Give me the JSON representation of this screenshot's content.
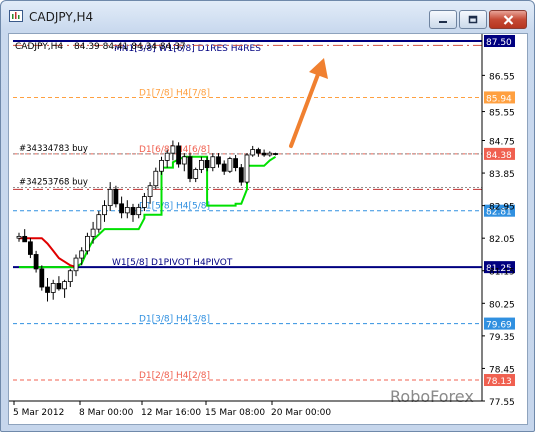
{
  "window": {
    "title": "CADJPY,H4",
    "icon": "chart-window-icon"
  },
  "chart_data": {
    "type": "candlestick",
    "symbol_header": "CADJPY,H4",
    "ohlc_header": "84.39 84.41 84.34 84.37",
    "watermark": "RoboForex",
    "ylim": [
      77.55,
      87.5
    ],
    "price_axis_ticks": [
      "86.55",
      "85.55",
      "84.75",
      "83.85",
      "82.95",
      "82.05",
      "81.15",
      "80.25",
      "79.35",
      "78.45",
      "77.55"
    ],
    "date_labels": [
      "5 Mar 2012",
      "8 Mar 00:00",
      "12 Mar 16:00",
      "15 Mar 08:00",
      "20 Mar 00:00"
    ],
    "levels": [
      {
        "price": 87.5,
        "label": "MN1[3/8] W1[6/8] D1RES H4RES",
        "tag": "87.50",
        "color": "#000080",
        "style": "solid",
        "tag_bg": "#000080",
        "tag_fg": "#ffffff"
      },
      {
        "price": 87.38,
        "label": "",
        "tag": "",
        "color": "#d05040",
        "style": "dashdot",
        "tag_bg": "",
        "tag_fg": ""
      },
      {
        "price": 85.94,
        "label": "D1[7/8] H4[7/8]",
        "tag": "85.94",
        "color": "#ffa040",
        "style": "dashed",
        "tag_bg": "#ffa040",
        "tag_fg": "#ffffff"
      },
      {
        "price": 84.38,
        "label": "D1[6/8] H4[6/8]",
        "tag": "84.38",
        "color": "#f06050",
        "style": "dashed",
        "tag_bg": "#f06050",
        "tag_fg": "#ffffff"
      },
      {
        "price": 83.4,
        "label": "",
        "tag": "",
        "color": "#c03030",
        "style": "dashdot",
        "tag_bg": "",
        "tag_fg": ""
      },
      {
        "price": 82.81,
        "label": "D1[5/8] H4[5/8]",
        "tag": "82.81",
        "color": "#3090e0",
        "style": "dashed",
        "tag_bg": "#3090e0",
        "tag_fg": "#ffffff"
      },
      {
        "price": 81.25,
        "label": "W1[5/8] D1PIVOT H4PIVOT",
        "tag": "81.25",
        "color": "#000080",
        "style": "solid",
        "tag_bg": "#000080",
        "tag_fg": "#ffffff"
      },
      {
        "price": 79.69,
        "label": "D1[3/8] H4[3/8]",
        "tag": "79.69",
        "color": "#3090e0",
        "style": "dashed",
        "tag_bg": "#3090e0",
        "tag_fg": "#ffffff"
      },
      {
        "price": 78.13,
        "label": "D1[2/8] H4[2/8]",
        "tag": "78.13",
        "color": "#f06050",
        "style": "dashed",
        "tag_bg": "#f06050",
        "tag_fg": "#ffffff"
      }
    ],
    "orders": [
      {
        "label": "#34334783 buy",
        "price": 84.38
      },
      {
        "label": "#34253768 buy",
        "price": 83.45
      }
    ],
    "colors": {
      "candles": "#000000",
      "trend_line_green": "#00e000",
      "trend_line_red": "#e00000",
      "arrow": "#f08030",
      "watermark": "#8a8a8a"
    },
    "candles": [
      [
        82.05,
        82.2,
        81.95,
        82.1
      ],
      [
        82.1,
        82.3,
        82.0,
        81.95
      ],
      [
        81.95,
        82.05,
        81.5,
        81.6
      ],
      [
        81.6,
        81.7,
        81.1,
        81.2
      ],
      [
        81.2,
        81.3,
        80.6,
        80.7
      ],
      [
        80.7,
        80.95,
        80.3,
        80.55
      ],
      [
        80.55,
        80.9,
        80.35,
        80.8
      ],
      [
        80.8,
        81.0,
        80.6,
        80.65
      ],
      [
        80.65,
        80.9,
        80.4,
        80.85
      ],
      [
        80.85,
        81.2,
        80.7,
        81.15
      ],
      [
        81.15,
        81.6,
        81.0,
        81.5
      ],
      [
        81.5,
        81.8,
        81.3,
        81.7
      ],
      [
        81.7,
        82.2,
        81.6,
        82.1
      ],
      [
        82.1,
        82.5,
        81.9,
        82.3
      ],
      [
        82.3,
        82.8,
        82.2,
        82.7
      ],
      [
        82.7,
        83.1,
        82.5,
        82.95
      ],
      [
        82.95,
        83.6,
        82.8,
        83.4
      ],
      [
        83.4,
        83.5,
        82.9,
        83.0
      ],
      [
        83.0,
        83.2,
        82.6,
        82.75
      ],
      [
        82.75,
        83.1,
        82.6,
        82.9
      ],
      [
        82.9,
        83.0,
        82.5,
        82.7
      ],
      [
        82.7,
        83.0,
        82.6,
        82.9
      ],
      [
        82.9,
        83.3,
        82.8,
        83.2
      ],
      [
        83.2,
        83.6,
        83.0,
        83.5
      ],
      [
        83.5,
        84.0,
        83.4,
        83.9
      ],
      [
        83.9,
        84.3,
        83.8,
        84.2
      ],
      [
        84.2,
        84.5,
        84.0,
        84.4
      ],
      [
        84.4,
        84.75,
        84.2,
        84.6
      ],
      [
        84.6,
        84.7,
        84.0,
        84.1
      ],
      [
        84.1,
        84.4,
        83.9,
        84.3
      ],
      [
        84.3,
        84.4,
        83.6,
        83.7
      ],
      [
        83.7,
        84.0,
        83.6,
        83.95
      ],
      [
        83.95,
        84.3,
        83.85,
        84.2
      ],
      [
        84.2,
        84.3,
        83.9,
        84.0
      ],
      [
        84.0,
        84.4,
        83.9,
        84.3
      ],
      [
        84.3,
        84.4,
        84.0,
        84.1
      ],
      [
        84.1,
        84.2,
        83.8,
        83.9
      ],
      [
        83.9,
        84.3,
        83.85,
        84.25
      ],
      [
        84.25,
        84.35,
        83.9,
        84.0
      ],
      [
        84.0,
        84.1,
        83.5,
        83.6
      ],
      [
        83.6,
        84.4,
        83.55,
        84.35
      ],
      [
        84.35,
        84.6,
        84.3,
        84.5
      ],
      [
        84.5,
        84.55,
        84.3,
        84.4
      ],
      [
        84.4,
        84.5,
        84.3,
        84.35
      ],
      [
        84.35,
        84.45,
        84.3,
        84.4
      ],
      [
        84.39,
        84.41,
        84.34,
        84.37
      ]
    ],
    "green_line": [
      [
        0,
        81.25
      ],
      [
        10,
        81.25
      ],
      [
        11,
        81.35
      ],
      [
        12,
        81.7
      ],
      [
        13,
        82.0
      ],
      [
        15,
        82.3
      ],
      [
        21,
        82.3
      ],
      [
        22,
        82.6
      ],
      [
        22,
        82.7
      ],
      [
        25,
        82.7
      ],
      [
        25,
        84.0
      ],
      [
        27,
        84.0
      ],
      [
        27,
        84.15
      ],
      [
        29,
        84.3
      ],
      [
        33,
        84.3
      ],
      [
        33,
        82.95
      ],
      [
        38,
        82.95
      ],
      [
        38,
        83.0
      ],
      [
        39,
        83.0
      ],
      [
        40,
        83.4
      ],
      [
        40,
        84.05
      ],
      [
        43,
        84.05
      ],
      [
        44,
        84.2
      ],
      [
        45,
        84.3
      ]
    ],
    "red_line": [
      [
        0,
        82.05
      ],
      [
        4,
        82.05
      ],
      [
        5,
        81.9
      ],
      [
        6,
        81.7
      ],
      [
        7,
        81.5
      ],
      [
        8,
        81.4
      ],
      [
        9,
        81.3
      ],
      [
        10,
        81.25
      ]
    ]
  }
}
